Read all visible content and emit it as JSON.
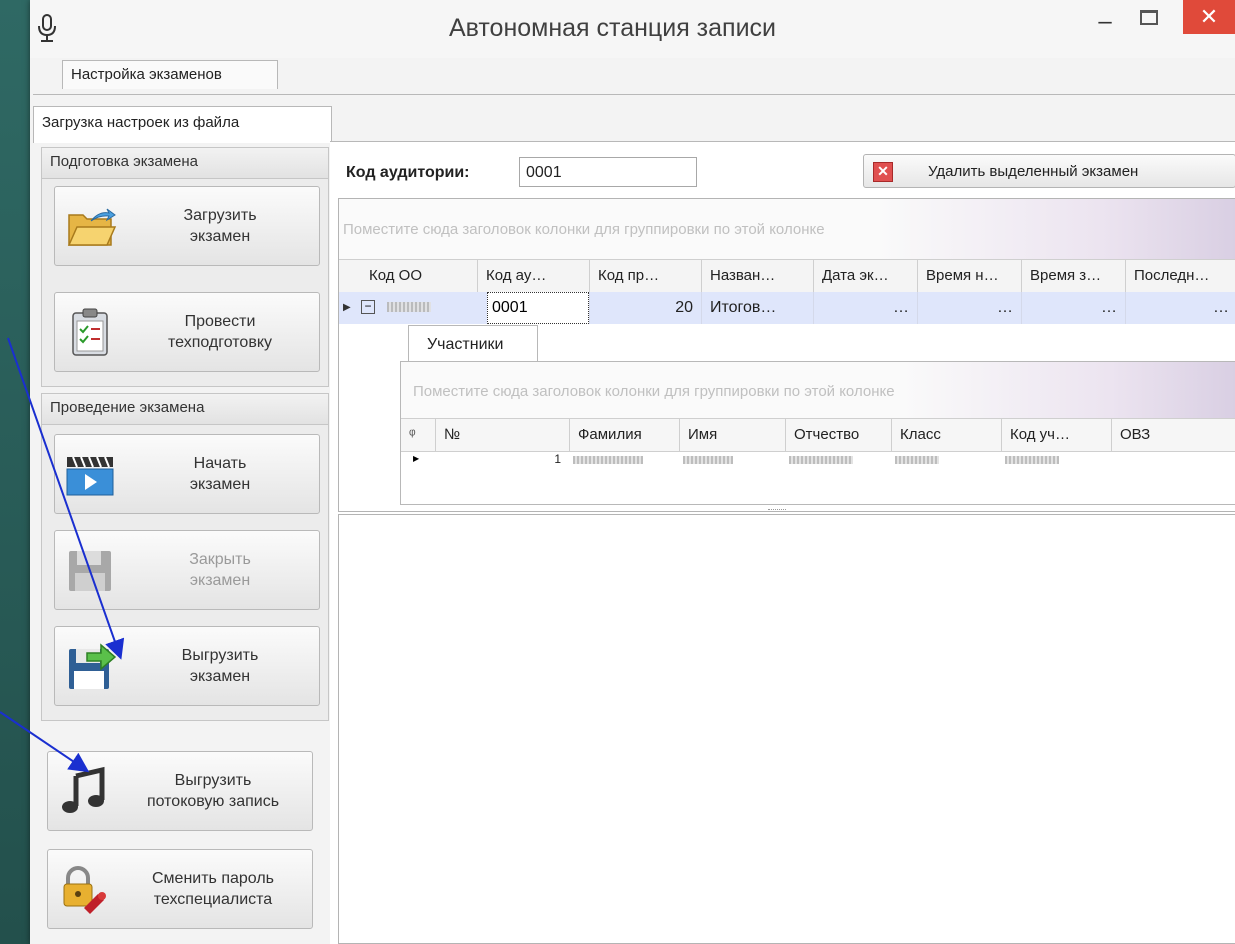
{
  "window": {
    "title": "Автономная станция записи",
    "minimize": "–",
    "close": "✕"
  },
  "tabs": {
    "top": "Настройка экзаменов",
    "sub": "Загрузка настроек из файла"
  },
  "sidebar": {
    "prep_group": "Подготовка экзамена",
    "load_exam": "Загрузить\nэкзамен",
    "tech_prep": "Провести\nтехподготовку",
    "run_group": "Проведение экзамена",
    "start_exam": "Начать\nэкзамен",
    "close_exam": "Закрыть\nэкзамен",
    "export_exam": "Выгрузить\nэкзамен",
    "export_stream": "Выгрузить\nпотоковую запись",
    "change_password": "Сменить пароль\nтехспециалиста"
  },
  "toolbar": {
    "auditorium_label": "Код аудитории:",
    "auditorium_value": "0001",
    "delete_button": "Удалить выделенный экзамен"
  },
  "grid": {
    "group_hint": "Поместите сюда заголовок колонки для группировки по этой колонке",
    "columns": [
      "Код ОО",
      "Код ау…",
      "Код пр…",
      "Назван…",
      "Дата эк…",
      "Время н…",
      "Время з…",
      "Последн…"
    ],
    "row": {
      "aud": "0001",
      "subject_code": "20",
      "name": "Итогов…",
      "date": "…",
      "time_start": "…",
      "time_end": "…",
      "last": "…"
    }
  },
  "detail": {
    "tab": "Участники",
    "group_hint": "Поместите сюда заголовок колонки для группировки по этой колонке",
    "search_icon": "ᵠ",
    "columns": [
      "№",
      "Фамилия",
      "Имя",
      "Отчество",
      "Класс",
      "Код уч…",
      "ОВЗ"
    ],
    "row_number": "1"
  },
  "colors": {
    "close_button": "#e04a3a",
    "selected_row": "#dfe6fb",
    "arrow": "#1a2fd0"
  }
}
